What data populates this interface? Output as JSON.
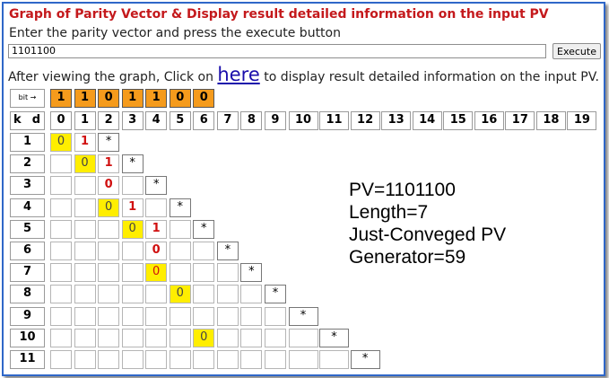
{
  "header": {
    "title": "Graph of Parity Vector & Display result detailed information on the input PV",
    "instruction": "Enter the parity vector and press the execute button",
    "after_before": "After viewing the graph, Click on ",
    "link_text": "here",
    "after_after": " to display result detailed information on the input PV."
  },
  "form": {
    "pv_value": "1101100",
    "execute_label": "Execute"
  },
  "grid": {
    "bit_label": "bit →",
    "bits": [
      "1",
      "1",
      "0",
      "1",
      "1",
      "0",
      "0"
    ],
    "k_label": "k",
    "d_label": "d",
    "columns": [
      "0",
      "1",
      "2",
      "3",
      "4",
      "5",
      "6",
      "7",
      "8",
      "9",
      "10",
      "11",
      "12",
      "13",
      "14",
      "15",
      "16",
      "17",
      "18",
      "19"
    ],
    "rows": [
      "1",
      "2",
      "3",
      "4",
      "5",
      "6",
      "7",
      "8",
      "9",
      "10",
      "11"
    ],
    "marks": [
      {
        "row": 0,
        "col": 0,
        "text": "0",
        "kind": "yellow"
      },
      {
        "row": 0,
        "col": 1,
        "text": "1",
        "kind": "red"
      },
      {
        "row": 0,
        "col": 2,
        "text": "*",
        "kind": "star"
      },
      {
        "row": 1,
        "col": 1,
        "text": "0",
        "kind": "yellow"
      },
      {
        "row": 1,
        "col": 2,
        "text": "1",
        "kind": "red"
      },
      {
        "row": 1,
        "col": 3,
        "text": "*",
        "kind": "star"
      },
      {
        "row": 2,
        "col": 2,
        "text": "0",
        "kind": "red"
      },
      {
        "row": 2,
        "col": 4,
        "text": "*",
        "kind": "star"
      },
      {
        "row": 3,
        "col": 2,
        "text": "0",
        "kind": "yellow"
      },
      {
        "row": 3,
        "col": 3,
        "text": "1",
        "kind": "red"
      },
      {
        "row": 3,
        "col": 5,
        "text": "*",
        "kind": "star"
      },
      {
        "row": 4,
        "col": 3,
        "text": "0",
        "kind": "yellow"
      },
      {
        "row": 4,
        "col": 4,
        "text": "1",
        "kind": "red"
      },
      {
        "row": 4,
        "col": 6,
        "text": "*",
        "kind": "star"
      },
      {
        "row": 5,
        "col": 4,
        "text": "0",
        "kind": "red"
      },
      {
        "row": 5,
        "col": 7,
        "text": "*",
        "kind": "star"
      },
      {
        "row": 6,
        "col": 4,
        "text": "0",
        "kind": "redyellow"
      },
      {
        "row": 6,
        "col": 8,
        "text": "*",
        "kind": "star"
      },
      {
        "row": 7,
        "col": 5,
        "text": "0",
        "kind": "yellow"
      },
      {
        "row": 7,
        "col": 9,
        "text": "*",
        "kind": "star"
      },
      {
        "row": 8,
        "col": 10,
        "text": "*",
        "kind": "star"
      },
      {
        "row": 9,
        "col": 6,
        "text": "0",
        "kind": "yellow"
      },
      {
        "row": 9,
        "col": 11,
        "text": "*",
        "kind": "star"
      },
      {
        "row": 10,
        "col": 12,
        "text": "*",
        "kind": "star"
      }
    ]
  },
  "info": {
    "pv": "PV=1101100",
    "length": "Length=7",
    "status": "Just-Conveged PV",
    "generator": "Generator=59"
  },
  "colors": {
    "title": "#c4191c",
    "bit_box": "#f59b1c",
    "highlight": "#ffee00",
    "digit_red": "#d01010",
    "frame": "#2f67c8"
  }
}
